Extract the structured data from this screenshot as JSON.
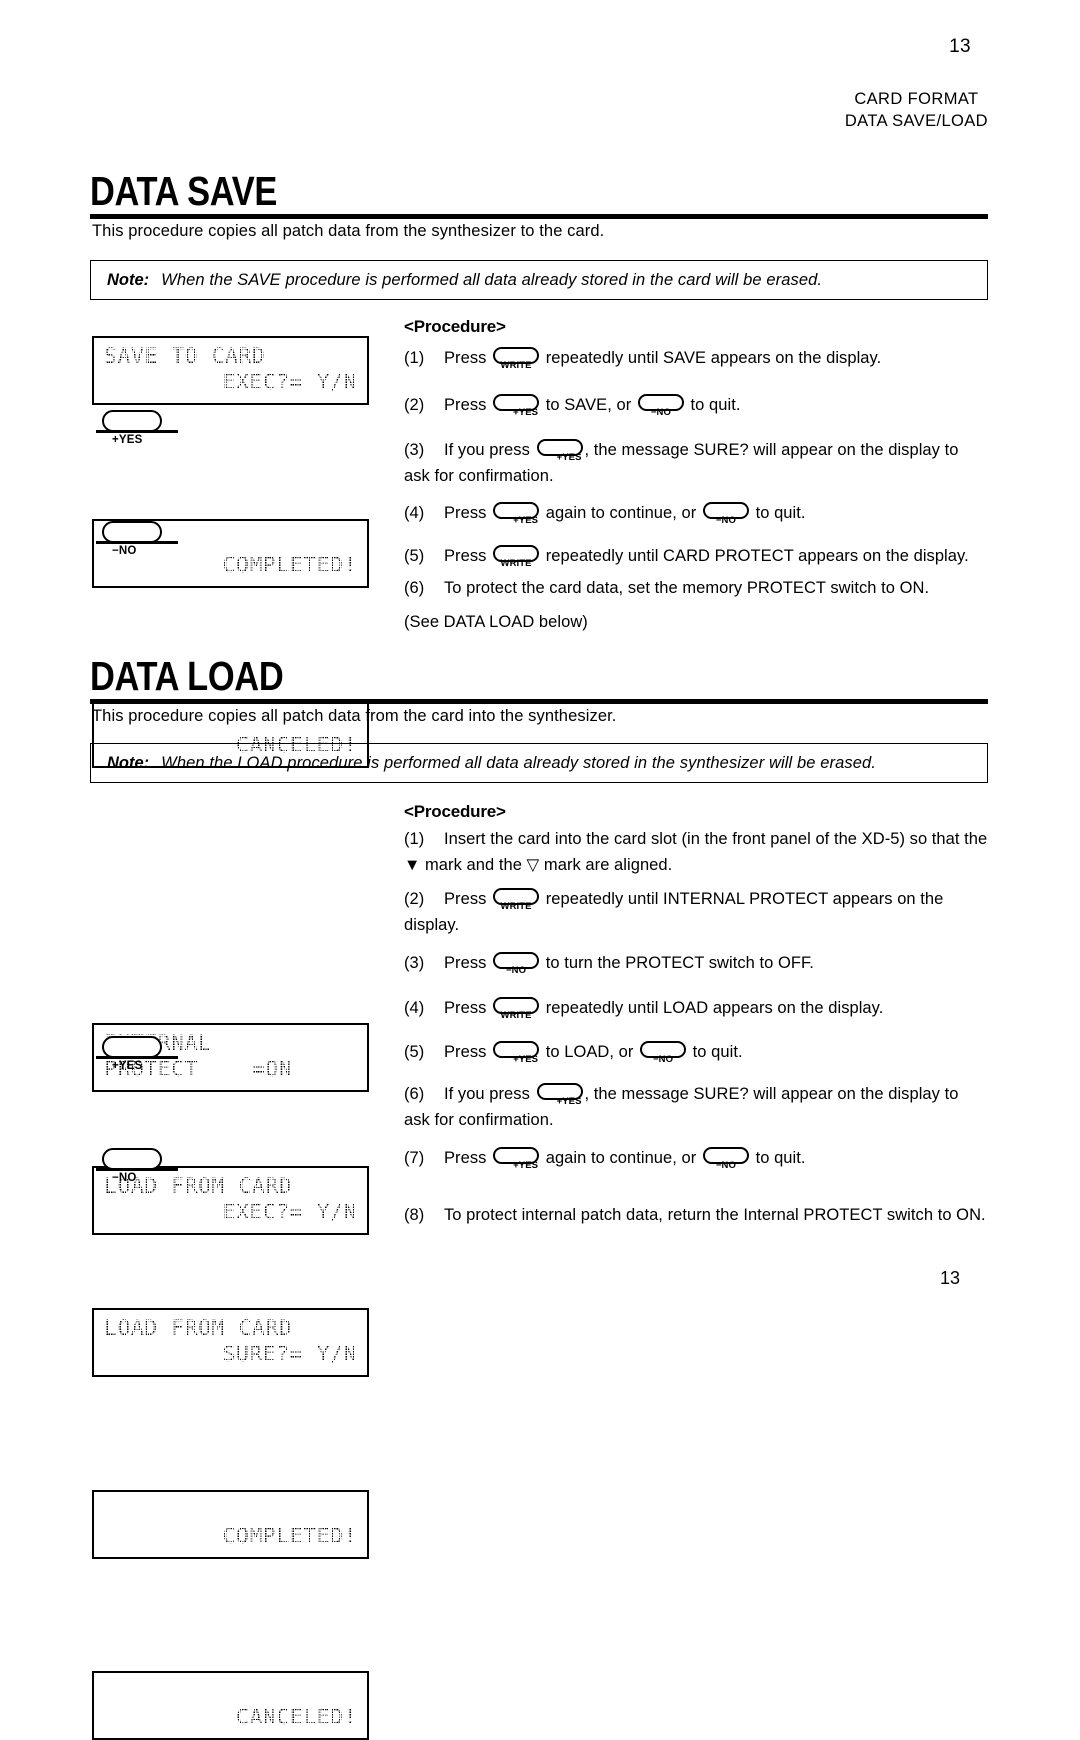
{
  "header": {
    "page_number_top": "13",
    "line1": "CARD FORMAT",
    "line2": "DATA SAVE/LOAD"
  },
  "footer": {
    "page_number_bottom": "13"
  },
  "sections": [
    {
      "title": "DATA SAVE",
      "intro": "This procedure copies all patch data from the synthesizer to the card.",
      "note_label": "Note:",
      "note_text": "When the SAVE procedure is performed all data already stored in the card will be erased.",
      "procedure_heading": "<Procedure>",
      "displays": [
        {
          "kind": "lcd",
          "line1": "SAVE TO CARD",
          "line2": "EXEC?= Y/N",
          "line1_align": "left",
          "line2_align": "right"
        },
        {
          "kind": "button",
          "label": "+YES"
        },
        {
          "kind": "lcd",
          "line1": "",
          "line2": "COMPLETED!",
          "line1_align": "left",
          "line2_align": "right"
        },
        {
          "kind": "button",
          "label": "−NO"
        },
        {
          "kind": "lcd",
          "line1": "",
          "line2": "CANCELED!",
          "line1_align": "left",
          "line2_align": "right"
        }
      ],
      "steps": [
        {
          "num": "(1)",
          "pre": "Press",
          "btn1": "WRITE",
          "mid": "repeatedly until SAVE appears on the display.",
          "btn2": "",
          "post": ""
        },
        {
          "num": "(2)",
          "pre": "Press",
          "btn1": "+YES",
          "mid": "to SAVE, or",
          "btn2": "−NO",
          "post": "to quit."
        },
        {
          "num": "(3)",
          "pre": "If you press",
          "btn1": "+YES",
          "mid": ", the message SURE? will appear on the display to ask for confirmation.",
          "btn2": "",
          "post": ""
        },
        {
          "num": "(4)",
          "pre": "Press",
          "btn1": "+YES",
          "mid": "again to continue, or",
          "btn2": "−NO",
          "post": "to quit."
        },
        {
          "num": "(5)",
          "pre": "Press",
          "btn1": "WRITE",
          "mid": "repeatedly until CARD PROTECT appears on the display.",
          "btn2": "",
          "post": ""
        },
        {
          "num": "(6)",
          "pre": "",
          "btn1": "",
          "mid": "To protect the card data, set the memory PROTECT switch to ON.",
          "btn2": "",
          "post": "",
          "extra": "(See DATA LOAD below)"
        }
      ]
    },
    {
      "title": "DATA LOAD",
      "intro": "This procedure copies all patch data from the card into the synthesizer.",
      "note_label": "Note:",
      "note_text": "When the LOAD procedure is performed all data already stored in the synthesizer will be erased.",
      "procedure_heading": "<Procedure>",
      "displays": [
        {
          "kind": "lcd",
          "line1": "INTERNAL",
          "line2": "PROTECT    =ON",
          "line1_align": "left",
          "line2_align": "left"
        },
        {
          "kind": "lcd",
          "line1": "LOAD FROM CARD",
          "line2": "EXEC?= Y/N",
          "line1_align": "left",
          "line2_align": "right"
        },
        {
          "kind": "lcd",
          "line1": "LOAD FROM CARD",
          "line2": "SURE?= Y/N",
          "line1_align": "left",
          "line2_align": "right"
        },
        {
          "kind": "button",
          "label": "+YES"
        },
        {
          "kind": "lcd",
          "line1": "",
          "line2": "COMPLETED!",
          "line1_align": "left",
          "line2_align": "right"
        },
        {
          "kind": "button",
          "label": "−NO"
        },
        {
          "kind": "lcd",
          "line1": "",
          "line2": "CANCELED!",
          "line1_align": "left",
          "line2_align": "right"
        }
      ],
      "steps": [
        {
          "num": "(1)",
          "pre": "",
          "btn1": "",
          "mid": "Insert the card into the card slot (in the front panel of the XD-5) so that the ▼ mark and the ▽ mark are aligned.",
          "btn2": "",
          "post": ""
        },
        {
          "num": "(2)",
          "pre": "Press",
          "btn1": "WRITE",
          "mid": "repeatedly until INTERNAL PROTECT appears on the display.",
          "btn2": "",
          "post": ""
        },
        {
          "num": "(3)",
          "pre": "Press",
          "btn1": "−NO",
          "mid": "to turn the PROTECT switch to OFF.",
          "btn2": "",
          "post": ""
        },
        {
          "num": "(4)",
          "pre": "Press",
          "btn1": "WRITE",
          "mid": "repeatedly until LOAD appears on the display.",
          "btn2": "",
          "post": ""
        },
        {
          "num": "(5)",
          "pre": "Press",
          "btn1": "+YES",
          "mid": "to LOAD, or",
          "btn2": "−NO",
          "post": "to quit."
        },
        {
          "num": "(6)",
          "pre": "If you press",
          "btn1": "+YES",
          "mid": ", the message SURE? will appear on the display to ask for confirmation.",
          "btn2": "",
          "post": ""
        },
        {
          "num": "(7)",
          "pre": "Press",
          "btn1": "+YES",
          "mid": "again to continue, or",
          "btn2": "−NO",
          "post": "to quit."
        },
        {
          "num": "(8)",
          "pre": "",
          "btn1": "",
          "mid": "To protect internal patch data, return the Internal PROTECT switch to ON.",
          "btn2": "",
          "post": ""
        }
      ]
    }
  ]
}
